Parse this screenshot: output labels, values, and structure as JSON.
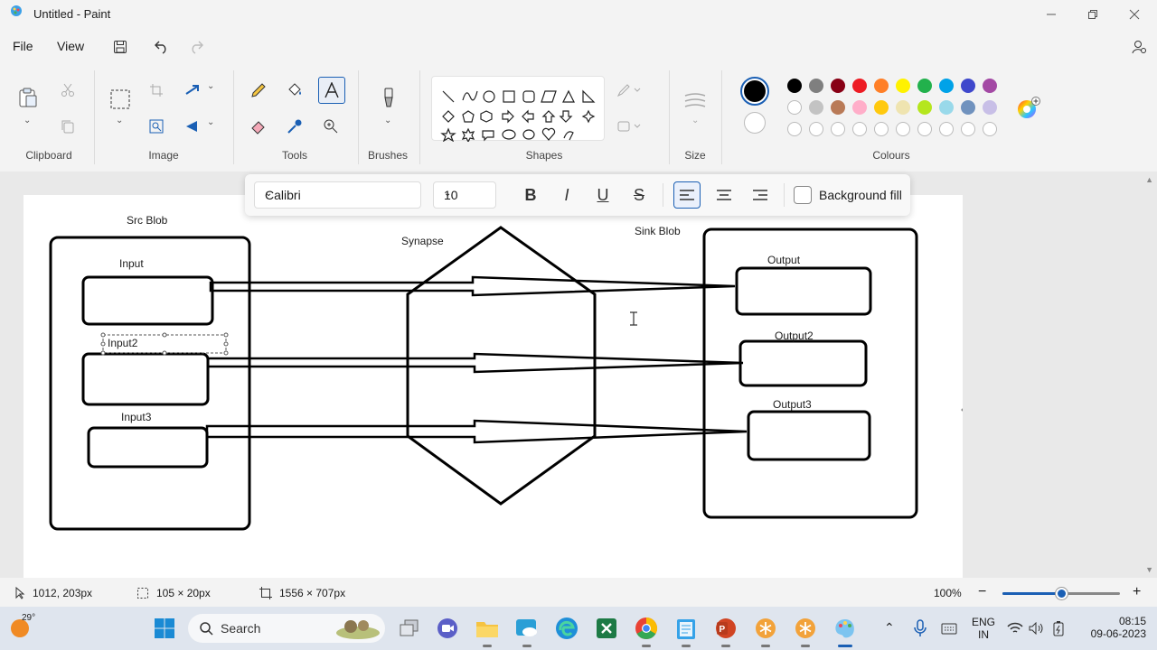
{
  "window": {
    "title": "Untitled - Paint"
  },
  "menu": {
    "file": "File",
    "view": "View"
  },
  "ribbon": {
    "groups": {
      "clipboard": "Clipboard",
      "image": "Image",
      "tools": "Tools",
      "brushes": "Brushes",
      "shapes": "Shapes",
      "size": "Size",
      "colours": "Colours"
    },
    "primary_color": "#000000",
    "secondary_color": "#ffffff",
    "palette_row1": [
      "#000000",
      "#7f7f7f",
      "#880015",
      "#ed1c24",
      "#ff7f27",
      "#fff200",
      "#22b14c",
      "#00a2e8",
      "#3f48cc",
      "#a349a4"
    ],
    "palette_row2": [
      "#ffffff",
      "#c3c3c3",
      "#b97a57",
      "#ffaec9",
      "#ffc90e",
      "#efe4b0",
      "#b5e61d",
      "#99d9ea",
      "#7092be",
      "#c8bfe7"
    ]
  },
  "textbar": {
    "font": "Calibri",
    "size": "10",
    "background_fill": "Background fill"
  },
  "diagram": {
    "src_title": "Src Blob",
    "synapse_title": "Synapse",
    "sink_title": "Sink Blob",
    "input1": "Input",
    "input2": "Input2",
    "input3": "Input3",
    "output1": "Output",
    "output2": "Output2",
    "output3": "Output3"
  },
  "status": {
    "cursor": "1012, 203px",
    "selection": "105 × 20px",
    "canvas_size": "1556 × 707px",
    "zoom": "100%",
    "zoom_level": 0.5
  },
  "taskbar": {
    "weather": "29°",
    "search": "Search",
    "lang1": "ENG",
    "lang2": "IN",
    "time": "08:15",
    "date": "09-06-2023"
  }
}
